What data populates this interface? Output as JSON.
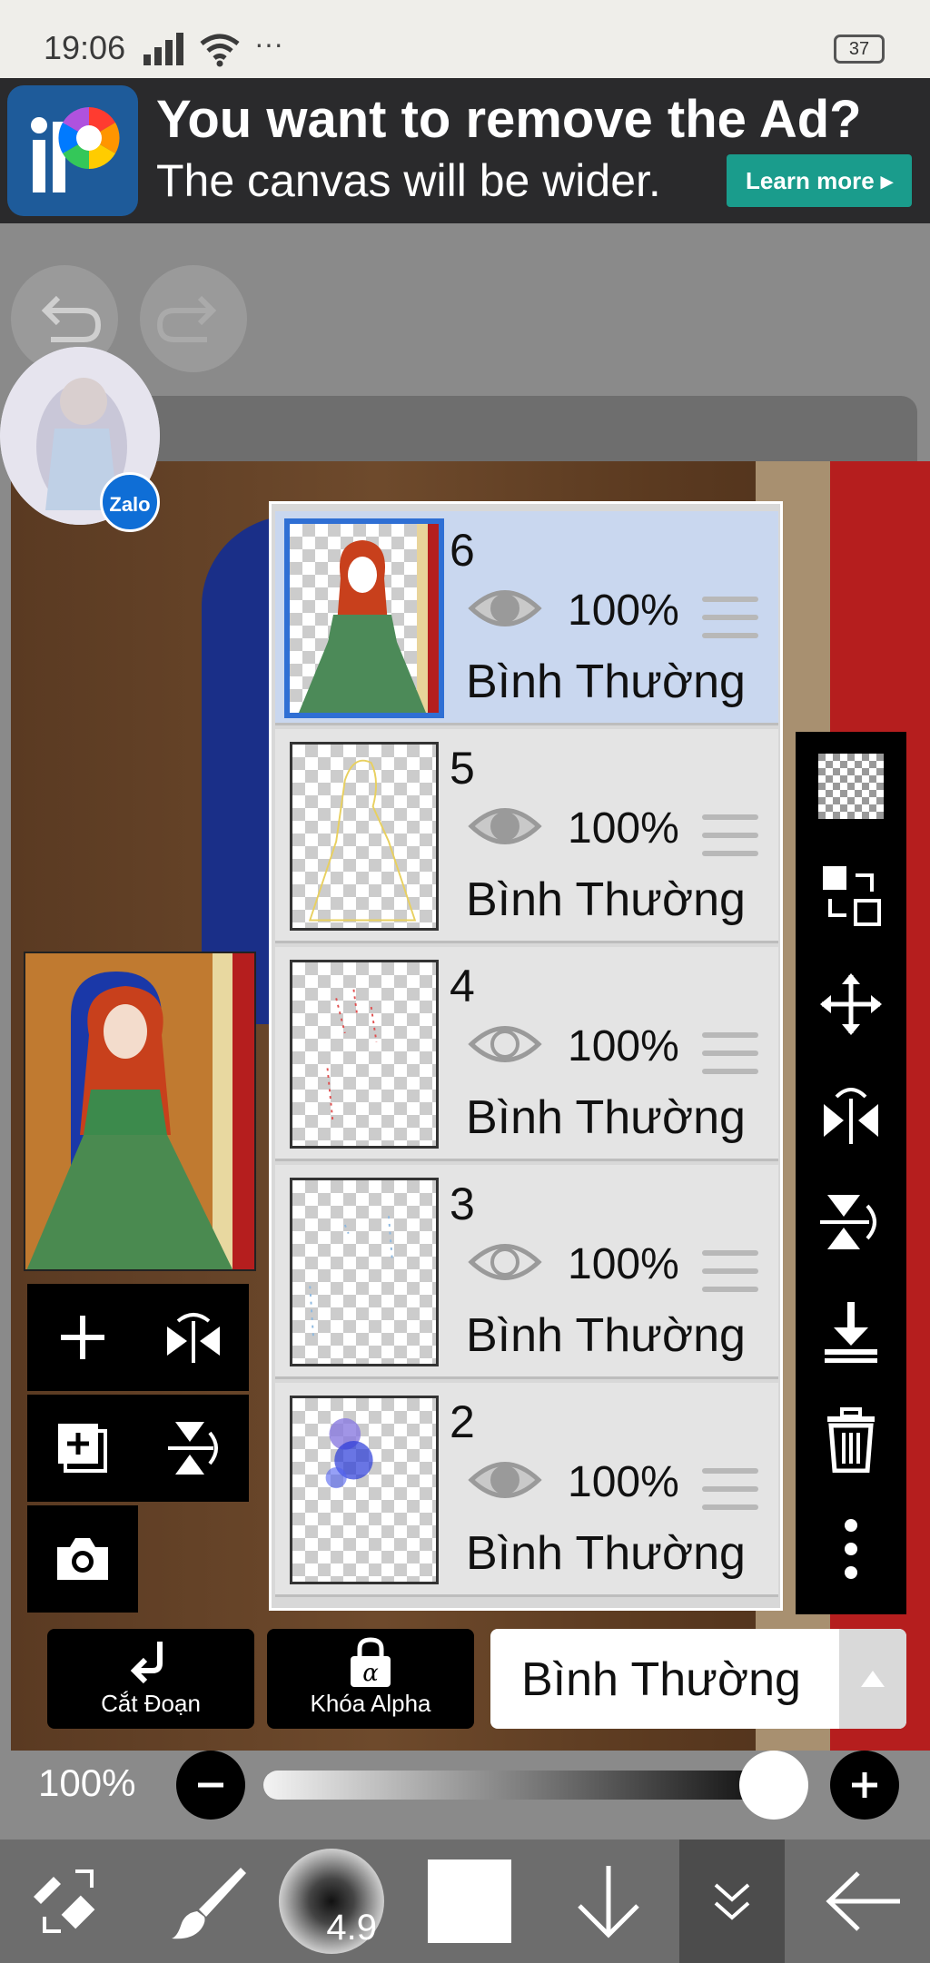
{
  "status_bar": {
    "time": "19:06",
    "dots": "···",
    "battery": "37"
  },
  "ad": {
    "title": "You want to remove the Ad?",
    "subtitle": "The canvas will be wider.",
    "button": "Learn more ▸"
  },
  "zalo": {
    "label": "Zalo"
  },
  "layers": [
    {
      "number": "6",
      "opacity": "100%",
      "blend": "Bình Thường",
      "selected": true,
      "visible": true
    },
    {
      "number": "5",
      "opacity": "100%",
      "blend": "Bình Thường",
      "selected": false,
      "visible": true
    },
    {
      "number": "4",
      "opacity": "100%",
      "blend": "Bình Thường",
      "selected": false,
      "visible": false
    },
    {
      "number": "3",
      "opacity": "100%",
      "blend": "Bình Thường",
      "selected": false,
      "visible": false
    },
    {
      "number": "2",
      "opacity": "100%",
      "blend": "Bình Thường",
      "selected": false,
      "visible": true
    }
  ],
  "controls": {
    "clip_label": "Cắt Đoạn",
    "alpha_label": "Khóa Alpha",
    "blend_mode": "Bình Thường",
    "opacity": "100%",
    "opacity_value": 1.0
  },
  "brush": {
    "size": "4.9"
  },
  "colors": {
    "accent": "#2f6fd4",
    "ad_button": "#1a9c8c",
    "selected_layer": "#c9d7ef"
  }
}
